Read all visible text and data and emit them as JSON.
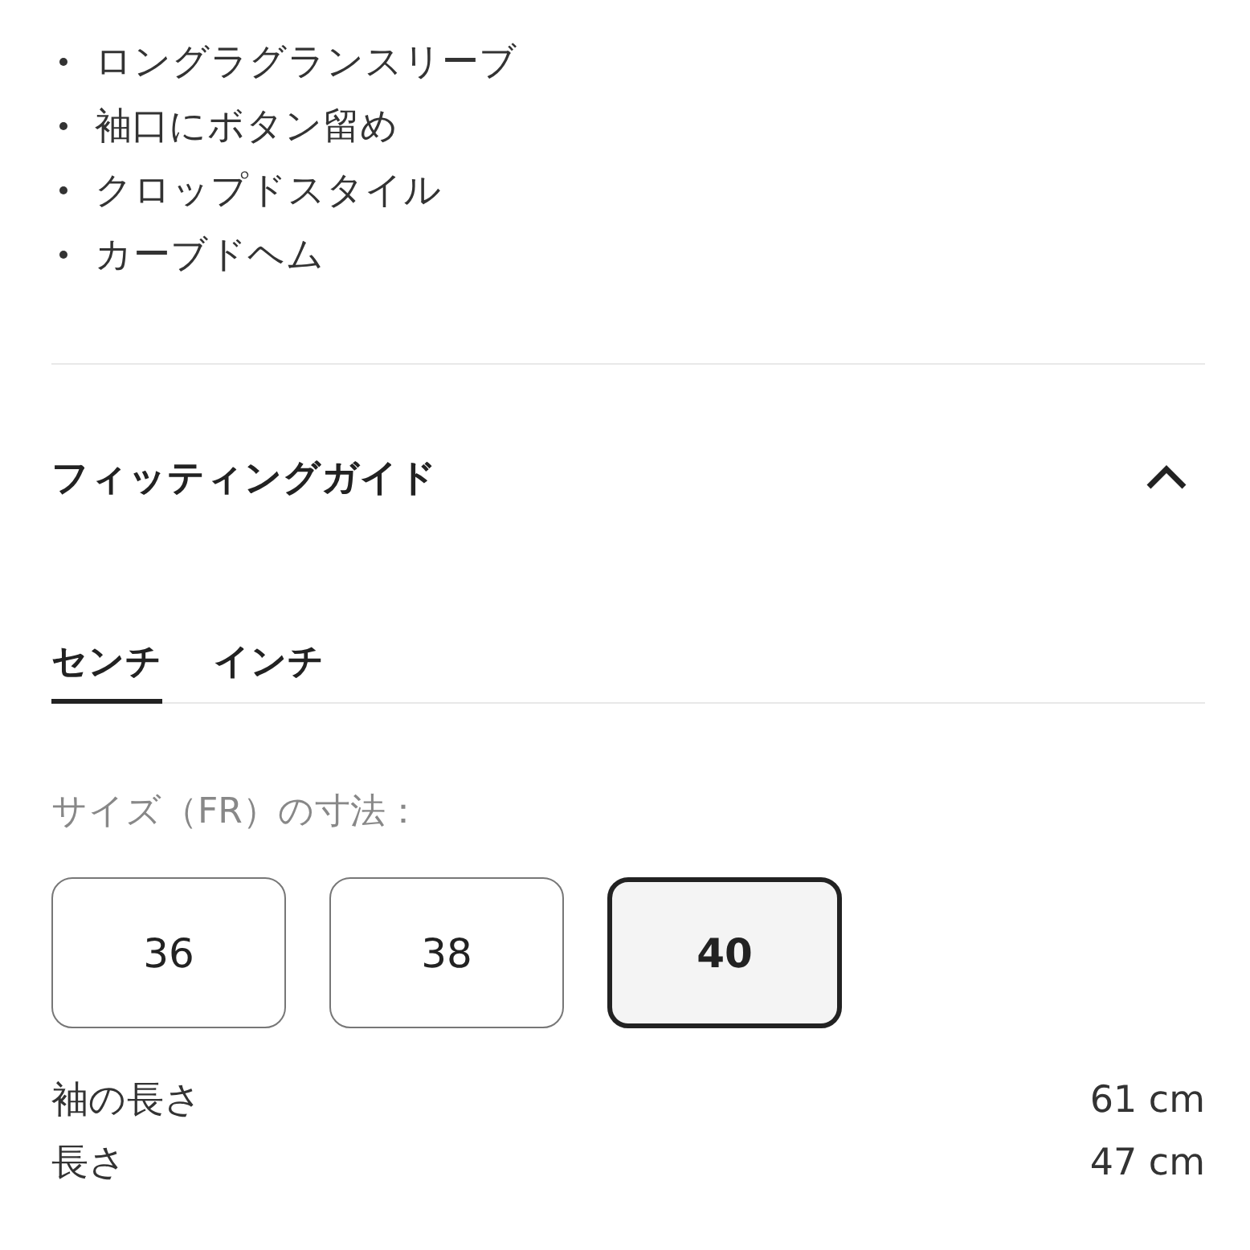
{
  "features": [
    "ロングラグランスリーブ",
    "袖口にボタン留め",
    "クロップドスタイル",
    "カーブドヘム"
  ],
  "fitting_guide": {
    "title": "フィッティングガイド",
    "expanded": true,
    "units": [
      {
        "label": "センチ",
        "selected": true
      },
      {
        "label": "インチ",
        "selected": false
      }
    ],
    "size_label": "サイズ（FR）の寸法：",
    "sizes": [
      {
        "label": "36",
        "selected": false
      },
      {
        "label": "38",
        "selected": false
      },
      {
        "label": "40",
        "selected": true
      }
    ],
    "measurements": [
      {
        "name": "袖の長さ",
        "value": "61 cm"
      },
      {
        "name": "長さ",
        "value": "47 cm"
      }
    ]
  }
}
